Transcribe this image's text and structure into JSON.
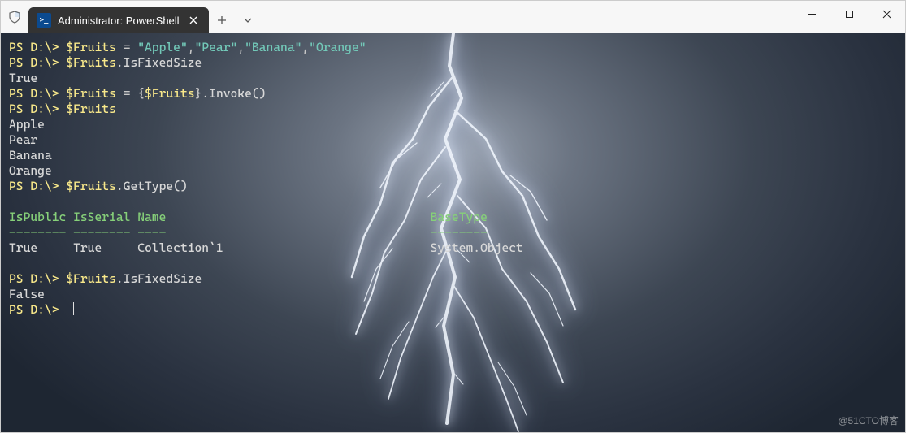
{
  "titlebar": {
    "tab_icon_text": ">_",
    "tab_title": "Administrator: PowerShell"
  },
  "colors": {
    "prompt": "#f8e88a",
    "string": "#72c8b8",
    "header": "#86d079",
    "text": "#d8d8d8"
  },
  "terminal": {
    "lines": [
      {
        "prompt": "PS D:\\>",
        "var": "$Fruits",
        "op": " = ",
        "strings": [
          "\"Apple\"",
          "\"Pear\"",
          "\"Banana\"",
          "\"Orange\""
        ],
        "sep": ","
      },
      {
        "prompt": "PS D:\\>",
        "var": "$Fruits",
        "tail": ".IsFixedSize"
      },
      {
        "out": "True"
      },
      {
        "prompt": "PS D:\\>",
        "var": "$Fruits",
        "op": " = ",
        "brace_open": "{",
        "var2": "$Fruits",
        "brace_close": "}",
        "tail": ".Invoke()"
      },
      {
        "prompt": "PS D:\\>",
        "var": "$Fruits"
      },
      {
        "out": "Apple"
      },
      {
        "out": "Pear"
      },
      {
        "out": "Banana"
      },
      {
        "out": "Orange"
      },
      {
        "prompt": "PS D:\\>",
        "var": "$Fruits",
        "tail": ".GetType()"
      },
      {
        "blank": true
      },
      {
        "header": true,
        "c0": "IsPublic",
        "c1": "IsSerial",
        "c2": "Name",
        "c3": "BaseType"
      },
      {
        "header_rule": true,
        "c0": "--------",
        "c1": "--------",
        "c2": "----",
        "c3": "--------"
      },
      {
        "row": true,
        "c0": "True",
        "c1": "True",
        "c2": "Collection`1",
        "c3": "System.Object"
      },
      {
        "blank": true
      },
      {
        "prompt": "PS D:\\>",
        "var": "$Fruits",
        "tail": ".IsFixedSize"
      },
      {
        "out": "False"
      },
      {
        "prompt": "PS D:\\>",
        "cursor": true
      }
    ],
    "col_positions": {
      "c0": 0,
      "c1": 9,
      "c2": 18,
      "c3": 59
    }
  },
  "watermark": "@51CTO博客"
}
